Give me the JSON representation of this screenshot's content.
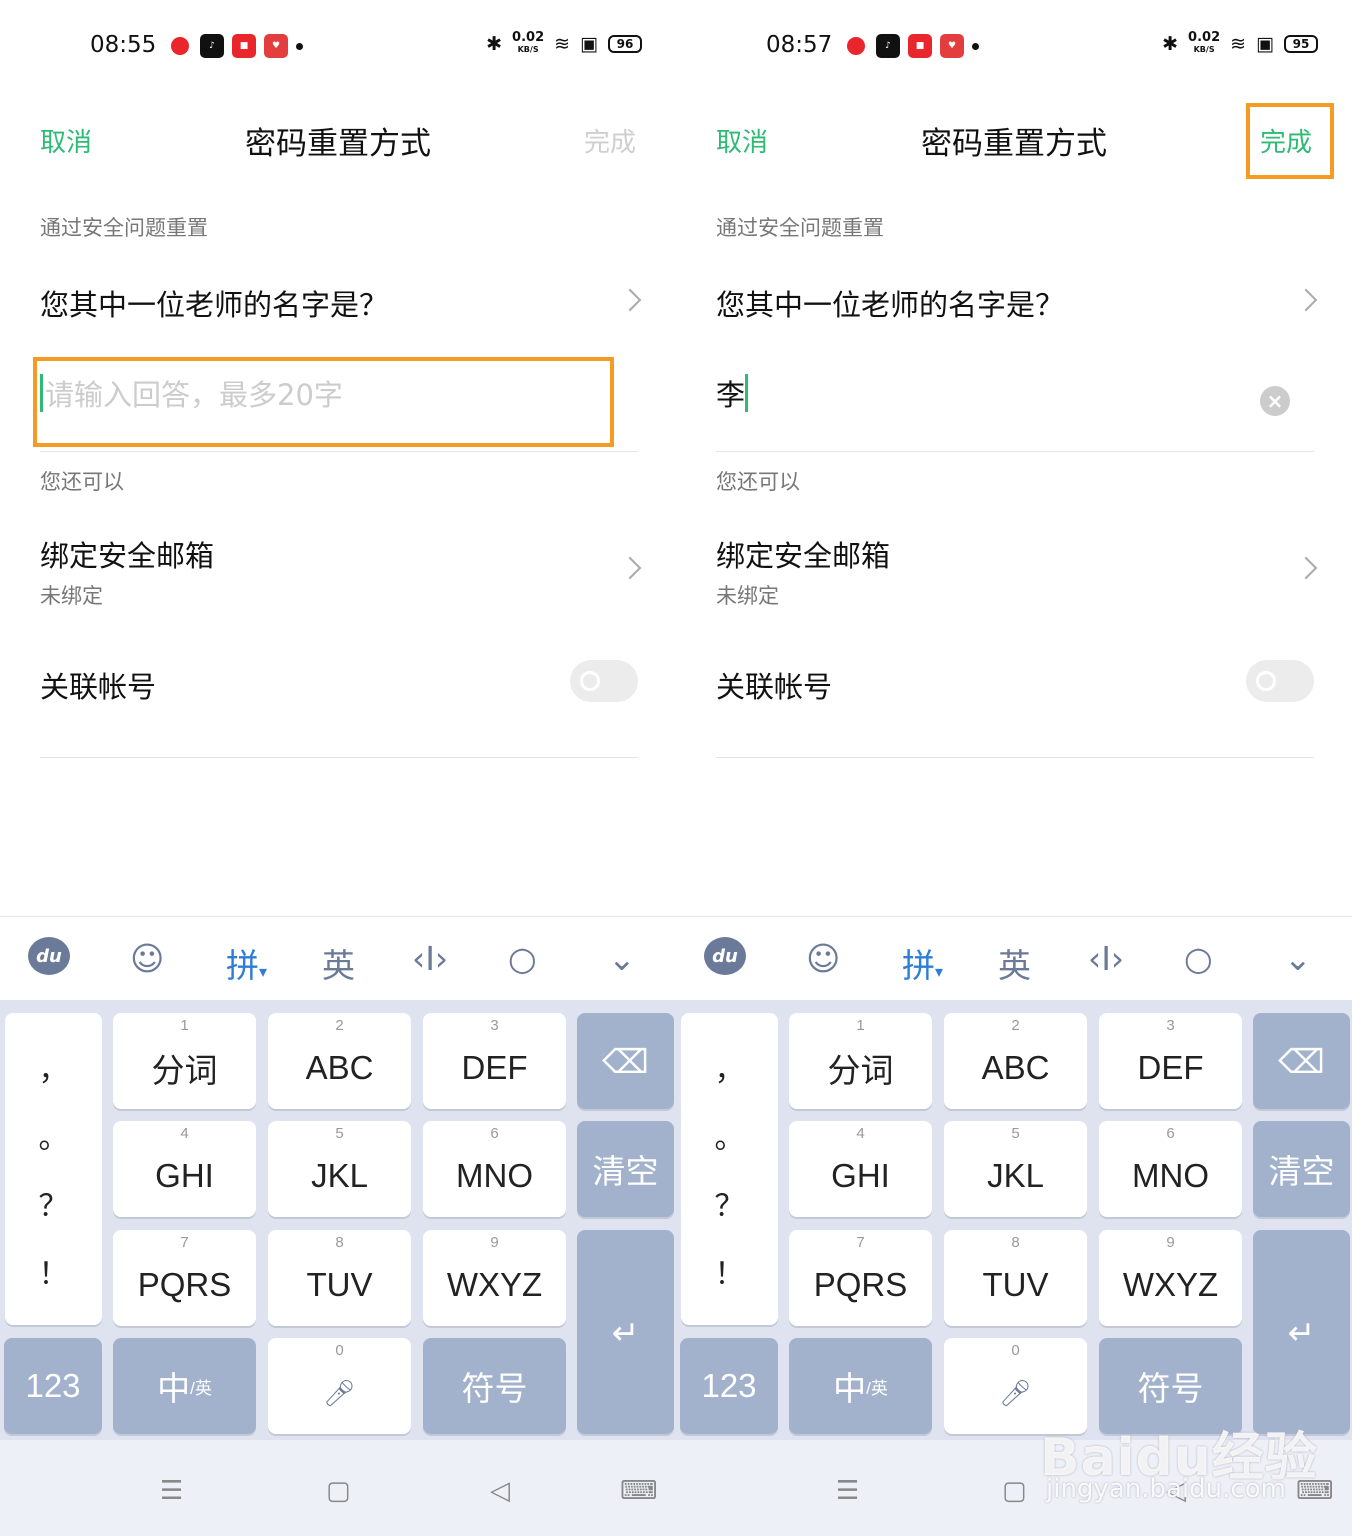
{
  "screens": [
    {
      "status": {
        "time": "08:55",
        "speed": "0.02",
        "speed_unit": "KB/S",
        "battery": "96"
      },
      "header": {
        "cancel": "取消",
        "title": "密码重置方式",
        "done": "完成"
      },
      "section_security": "通过安全问题重置",
      "question": "您其中一位老师的名字是？",
      "answer": {
        "value": "",
        "placeholder": "请输入回答，最多20字"
      },
      "section_more": "您还可以",
      "email": {
        "title": "绑定安全邮箱",
        "sub": "未绑定"
      },
      "linked": {
        "title": "关联帐号"
      },
      "done_active": false
    },
    {
      "status": {
        "time": "08:57",
        "speed": "0.02",
        "speed_unit": "KB/S",
        "battery": "95"
      },
      "header": {
        "cancel": "取消",
        "title": "密码重置方式",
        "done": "完成"
      },
      "section_security": "通过安全问题重置",
      "question": "您其中一位老师的名字是？",
      "answer": {
        "value": "李",
        "placeholder": ""
      },
      "section_more": "您还可以",
      "email": {
        "title": "绑定安全邮箱",
        "sub": "未绑定"
      },
      "linked": {
        "title": "关联帐号"
      },
      "done_active": true
    }
  ],
  "keyboard": {
    "toolbar": {
      "pinyin": "拼",
      "english": "英"
    },
    "punct": [
      "，",
      "。",
      "？",
      "！"
    ],
    "keys": [
      {
        "num": "1",
        "label": "分词"
      },
      {
        "num": "2",
        "label": "ABC"
      },
      {
        "num": "3",
        "label": "DEF"
      },
      {
        "num": "4",
        "label": "GHI"
      },
      {
        "num": "5",
        "label": "JKL"
      },
      {
        "num": "6",
        "label": "MNO"
      },
      {
        "num": "7",
        "label": "PQRS"
      },
      {
        "num": "8",
        "label": "TUV"
      },
      {
        "num": "9",
        "label": "WXYZ"
      }
    ],
    "clear": "清空",
    "num_key": "123",
    "lang_key": "中",
    "lang_key_small": "/英",
    "space_num": "0",
    "symbol_key": "符号"
  },
  "watermark": {
    "text": "Baidu经验",
    "url": "jingyan.baidu.com"
  },
  "colors": {
    "accent": "#2fba75",
    "highlight": "#f59a23",
    "keyboard_dark": "#a3b2cc"
  }
}
